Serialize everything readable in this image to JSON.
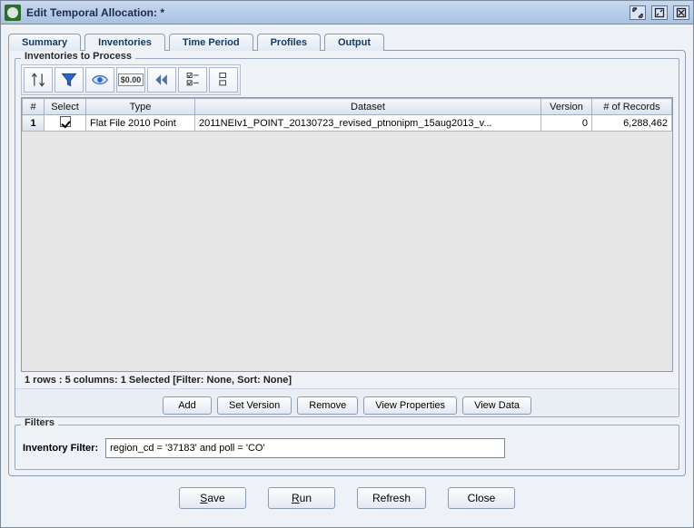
{
  "window": {
    "title": "Edit Temporal Allocation:  *",
    "controls": {
      "min": "▫",
      "max": "▣",
      "close": "⊠"
    }
  },
  "tabs": [
    {
      "label": "Summary",
      "active": false
    },
    {
      "label": "Inventories",
      "active": true
    },
    {
      "label": "Time Period",
      "active": false
    },
    {
      "label": "Profiles",
      "active": false
    },
    {
      "label": "Output",
      "active": false
    }
  ],
  "inventories_panel": {
    "legend": "Inventories to Process",
    "toolbar_icons": [
      "sort",
      "filter",
      "view",
      "format",
      "first",
      "select-cols",
      "clear-rows"
    ],
    "columns": [
      "#",
      "Select",
      "Type",
      "Dataset",
      "Version",
      "# of Records"
    ],
    "rows": [
      {
        "num": "1",
        "selected": true,
        "type": "Flat File 2010 Point",
        "dataset": "2011NEIv1_POINT_20130723_revised_ptnonipm_15aug2013_v...",
        "version": "0",
        "records": "6,288,462"
      }
    ],
    "status": "1 rows : 5 columns: 1 Selected [Filter: None, Sort: None]",
    "buttons": [
      "Add",
      "Set Version",
      "Remove",
      "View Properties",
      "View Data"
    ]
  },
  "filters": {
    "legend": "Filters",
    "label": "Inventory Filter:",
    "value": "region_cd = '37183' and poll = 'CO'"
  },
  "bottom": {
    "save": {
      "full": "Save",
      "mnemonic": "S",
      "rest": "ave"
    },
    "run": {
      "full": "Run",
      "mnemonic": "R",
      "rest": "un"
    },
    "refresh": {
      "full": "Refresh",
      "mnemonic": "",
      "rest": "Refresh"
    },
    "close": {
      "full": "Close",
      "mnemonic": "",
      "rest": "Close"
    }
  }
}
